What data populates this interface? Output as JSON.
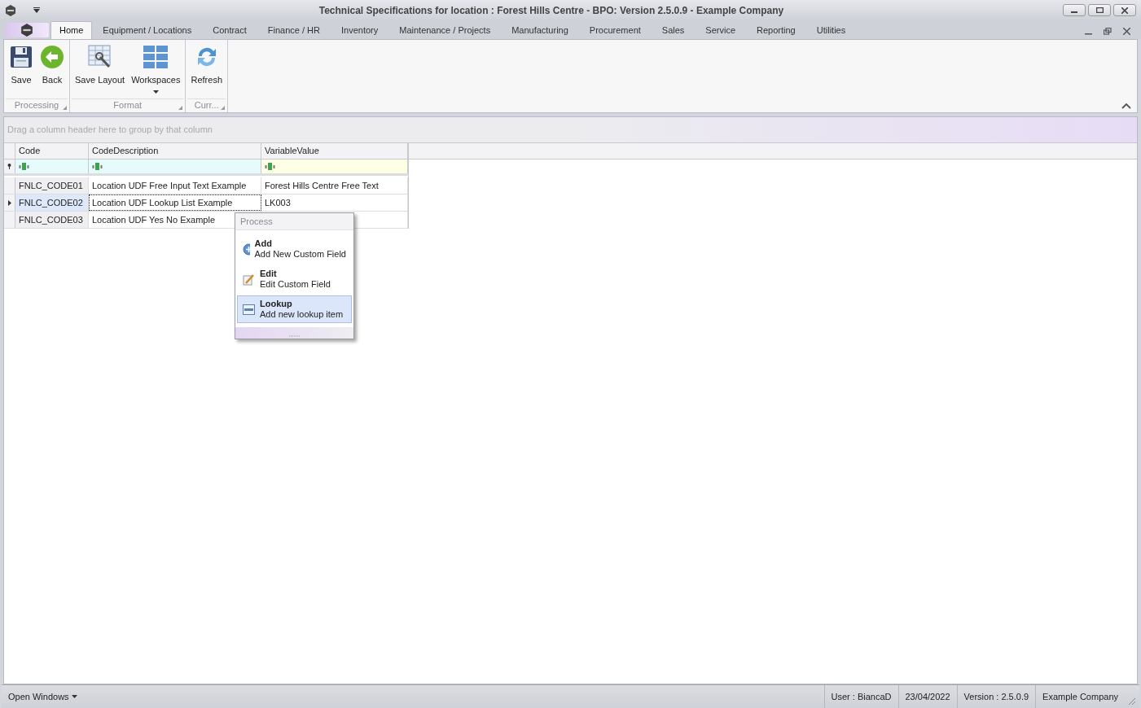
{
  "window": {
    "title": "Technical Specifications for location : Forest Hills Centre - BPO: Version 2.5.0.9 - Example Company"
  },
  "ribbon_tabs": [
    {
      "label": "Home",
      "selected": true
    },
    {
      "label": "Equipment / Locations",
      "selected": false
    },
    {
      "label": "Contract",
      "selected": false
    },
    {
      "label": "Finance / HR",
      "selected": false
    },
    {
      "label": "Inventory",
      "selected": false
    },
    {
      "label": "Maintenance / Projects",
      "selected": false
    },
    {
      "label": "Manufacturing",
      "selected": false
    },
    {
      "label": "Procurement",
      "selected": false
    },
    {
      "label": "Sales",
      "selected": false
    },
    {
      "label": "Service",
      "selected": false
    },
    {
      "label": "Reporting",
      "selected": false
    },
    {
      "label": "Utilities",
      "selected": false
    }
  ],
  "ribbon_groups": [
    {
      "label": "Processing",
      "buttons": [
        {
          "label": "Save",
          "kind": "save"
        },
        {
          "label": "Back",
          "kind": "back"
        }
      ]
    },
    {
      "label": "Format",
      "buttons": [
        {
          "label": "Save Layout",
          "kind": "layout"
        },
        {
          "label": "Workspaces",
          "kind": "workspaces"
        }
      ]
    },
    {
      "label": "Curr...",
      "buttons": [
        {
          "label": "Refresh",
          "kind": "refresh"
        }
      ]
    }
  ],
  "group_panel": {
    "placeholder": "Drag a column header here to group by that column"
  },
  "table": {
    "columns": [
      "Code",
      "CodeDescription",
      "VariableValue"
    ],
    "rows": [
      {
        "cells": [
          "FNLC_CODE01",
          "Location UDF Free Input Text Example",
          "Forest Hills Centre Free Text"
        ],
        "selected": false
      },
      {
        "cells": [
          "FNLC_CODE02",
          "Location UDF Lookup List Example",
          "LK003"
        ],
        "selected": true
      },
      {
        "cells": [
          "FNLC_CODE03",
          "Location UDF Yes No Example"
        ],
        "selected": false
      }
    ]
  },
  "context_menu": {
    "header": "Process",
    "items": [
      {
        "title": "Add",
        "subtitle": "Add New Custom Field",
        "kind": "add",
        "selected": false
      },
      {
        "title": "Edit",
        "subtitle": "Edit Custom Field",
        "kind": "edit",
        "selected": false
      },
      {
        "title": "Lookup",
        "subtitle": "Add new lookup item",
        "kind": "lookup",
        "selected": true
      }
    ]
  },
  "status_bar": {
    "open_windows": "Open Windows",
    "fields": [
      "User : BiancaD",
      "23/04/2022",
      "Version : 2.5.0.9",
      "Example Company"
    ]
  }
}
